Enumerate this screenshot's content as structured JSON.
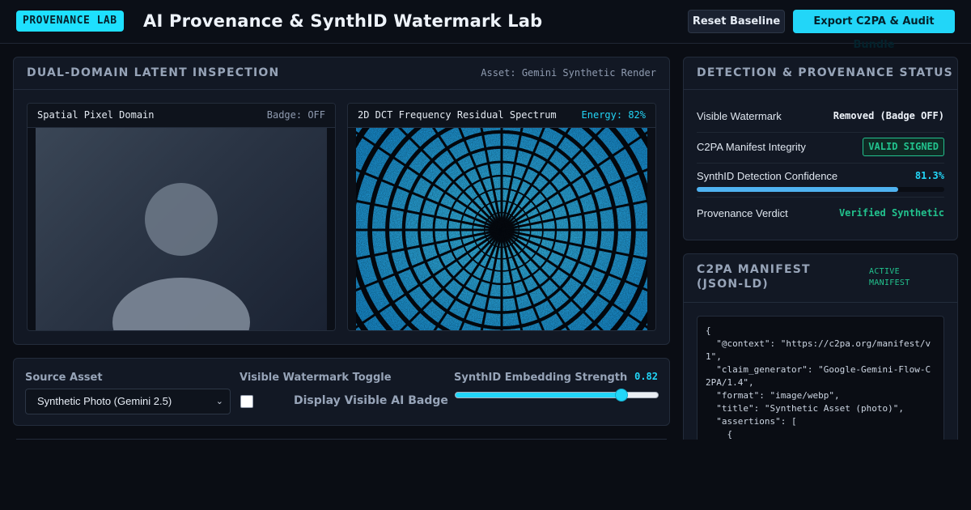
{
  "header": {
    "brand_badge": "PROVENANCE LAB",
    "title": "AI Provenance & SynthID Watermark Lab",
    "reset_label": "Reset Baseline",
    "export_label": "Export C2PA & Audit Bundle"
  },
  "inspection": {
    "title": "DUAL-DOMAIN LATENT INSPECTION",
    "asset_meta": "Asset: Gemini Synthetic Render",
    "spatial": {
      "title": "Spatial Pixel Domain",
      "status": "Badge: OFF"
    },
    "frequency": {
      "title": "2D DCT Frequency Residual Spectrum",
      "status": "Energy: 82%"
    }
  },
  "controls": {
    "source_label": "Source Asset",
    "source_value": "Synthetic Photo (Gemini 2.5)",
    "toggle_label": "Visible Watermark Toggle",
    "toggle_text": "Display Visible AI Badge",
    "toggle_checked": false,
    "strength_label": "SynthID Embedding Strength",
    "strength_value": "0.82",
    "strength_fraction": 0.82
  },
  "detection": {
    "title": "DETECTION & PROVENANCE STATUS",
    "rows": [
      {
        "label": "Visible Watermark",
        "value": "Removed (Badge OFF)"
      },
      {
        "label": "C2PA Manifest Integrity",
        "value": "VALID SIGNED"
      },
      {
        "label": "SynthID Detection Confidence",
        "value": "81.3%"
      },
      {
        "label": "Provenance Verdict",
        "value": "Verified Synthetic"
      }
    ],
    "confidence_fraction": 0.813
  },
  "manifest": {
    "title": "C2PA MANIFEST (JSON-LD)",
    "tag": "ACTIVE MANIFEST",
    "lines": [
      "{",
      "  \"@context\": \"https://c2pa.org/manifest/v1\",",
      "  \"claim_generator\": \"Google-Gemini-Flow-C2PA/1.4\",",
      "  \"format\": \"image/webp\",",
      "  \"title\": \"Synthetic Asset (photo)\",",
      "  \"assertions\": [",
      "    {"
    ]
  },
  "colors": {
    "accent": "#22d6f8",
    "success": "#22c38e",
    "background": "#0a0d14",
    "panel": "#121824"
  }
}
